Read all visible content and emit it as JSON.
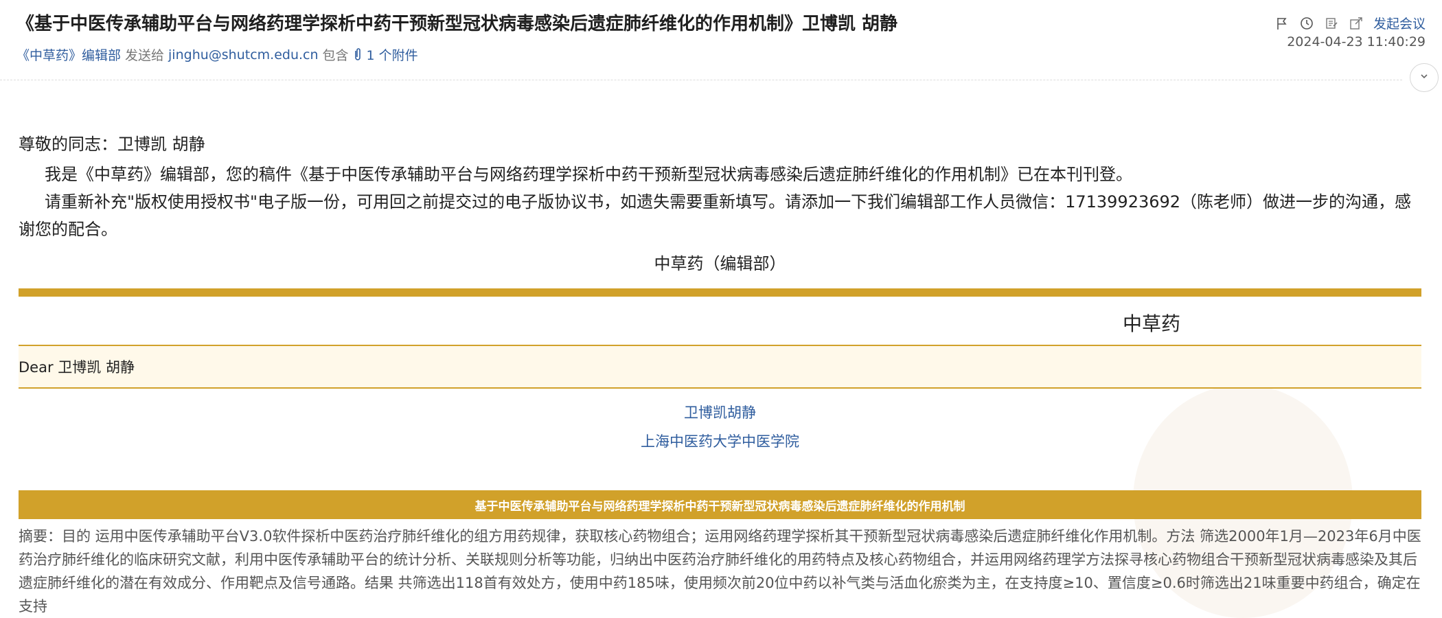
{
  "email": {
    "subject": "《基于中医传承辅助平台与网络药理学探析中药干预新型冠状病毒感染后遗症肺纤维化的作用机制》卫博凯 胡静",
    "sender": "《中草药》编辑部",
    "sent_to_label": "发送给",
    "recipient": "jinghu@shutcm.edu.cn",
    "contains_label": "包含",
    "attachments_label": "1 个附件",
    "meeting_label": "发起会议",
    "datetime": "2024-04-23 11:40:29"
  },
  "toolbar": {
    "icons": [
      "flag-icon",
      "clock-icon",
      "note-icon",
      "share-icon"
    ]
  },
  "body": {
    "greeting": "尊敬的同志：卫博凯 胡静",
    "paragraph1": "我是《中草药》编辑部，您的稿件《基于中医传承辅助平台与网络药理学探析中药干预新型冠状病毒感染后遗症肺纤维化的作用机制》已在本刊刊登。",
    "paragraph2": "请重新补充\"版权使用授权书\"电子版一份，可用回之前提交过的电子版协议书，如遗失需要重新填写。请添加一下我们编辑部工作人员微信：17139923692（陈老师）做进一步的沟通，感谢您的配合。",
    "signature": "中草药（编辑部）",
    "brand": "中草药",
    "dear_line": "Dear 卫博凯 胡静",
    "authors": "卫博凯胡静",
    "affiliation": "上海中医药大学中医学院",
    "article_title": "基于中医传承辅助平台与网络药理学探析中药干预新型冠状病毒感染后遗症肺纤维化的作用机制",
    "abstract": "摘要：目的 运用中医传承辅助平台V3.0软件探析中医药治疗肺纤维化的组方用药规律，获取核心药物组合；运用网络药理学探析其干预新型冠状病毒感染后遗症肺纤维化作用机制。方法 筛选2000年1月—2023年6月中医药治疗肺纤维化的临床研究文献，利用中医传承辅助平台的统计分析、关联规则分析等功能，归纳出中医药治疗肺纤维化的用药特点及核心药物组合，并运用网络药理学方法探寻核心药物组合干预新型冠状病毒感染及其后遗症肺纤维化的潜在有效成分、作用靶点及信号通路。结果 共筛选出118首有效处方，使用中药185味，使用频次前20位中药以补气类与活血化瘀类为主，在支持度≥10、置信度≥0.6时筛选出21味重要中药组合，确定在支持"
  },
  "colors": {
    "accent_gold": "#d1a12a",
    "link_blue": "#2f5d9e"
  }
}
